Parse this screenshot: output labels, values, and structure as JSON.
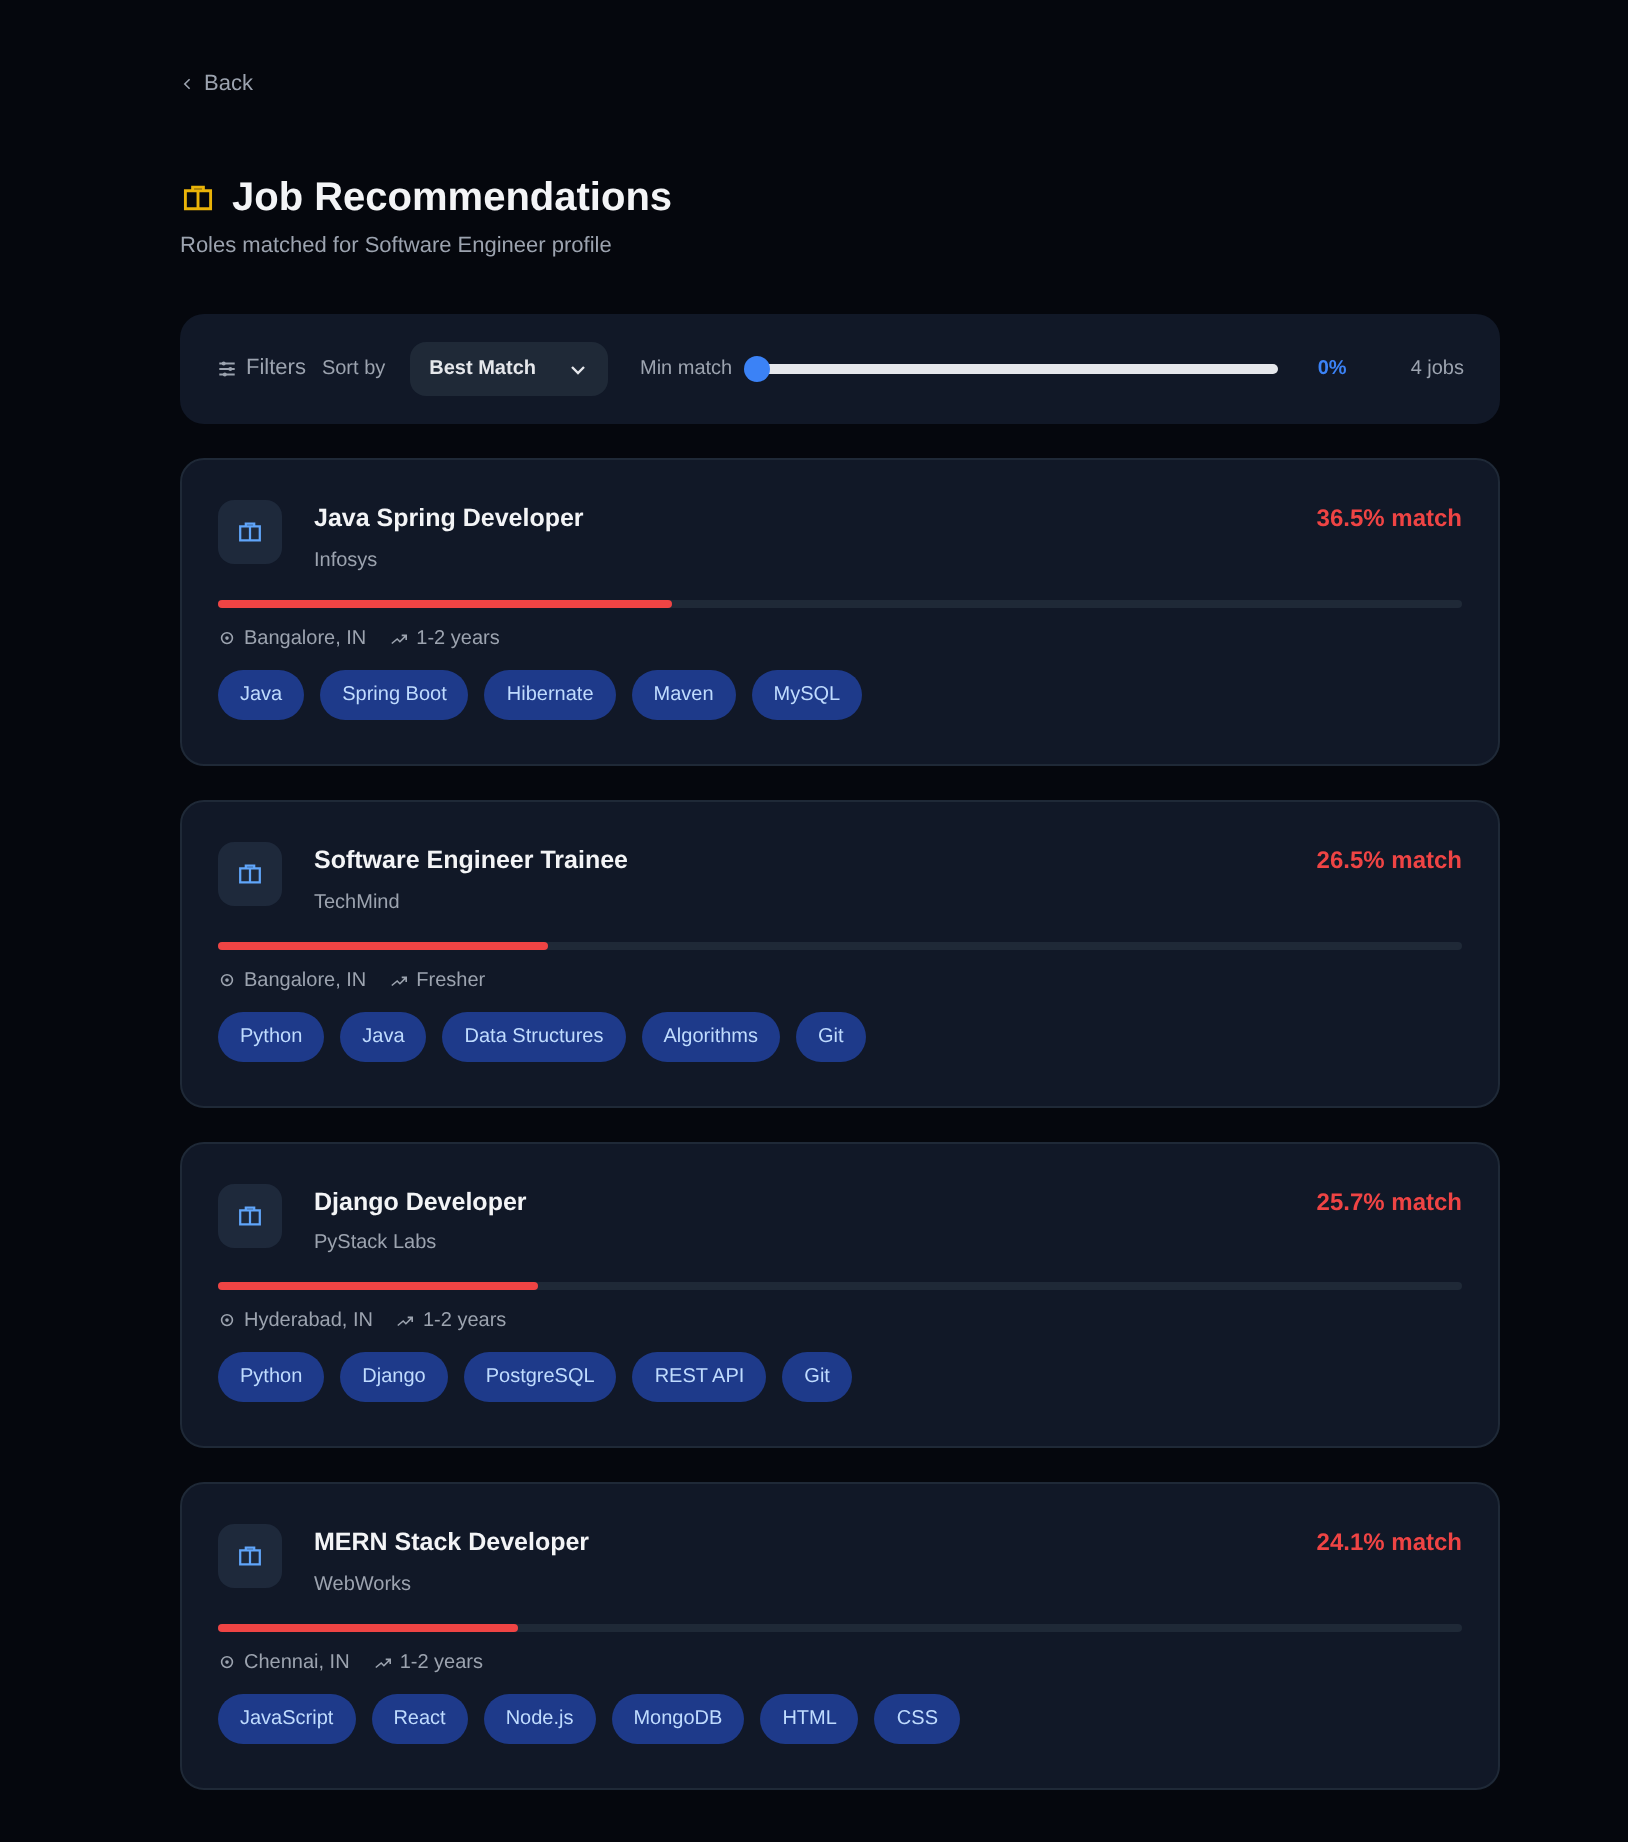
{
  "back": {
    "label": "Back"
  },
  "header": {
    "title": "Job Recommendations",
    "subtitle": "Roles matched for Software Engineer profile"
  },
  "filters": {
    "label": "Filters",
    "sort_label": "Sort by",
    "sort_value": "Best Match",
    "min_match_label": "Min match",
    "min_match": {
      "level": 0
    },
    "min_match_reading": "0%",
    "count": "4 jobs"
  },
  "jobs": [
    {
      "title": "Java Spring Developer",
      "company": "Infosys",
      "match": "36.5% match",
      "level": 0.365,
      "location": "Bangalore, IN",
      "experience": "1-2 years",
      "skills": [
        "Java",
        "Spring Boot",
        "Hibernate",
        "Maven",
        "MySQL"
      ]
    },
    {
      "title": "Software Engineer Trainee",
      "company": "TechMind",
      "match": "26.5% match",
      "level": 0.265,
      "location": "Bangalore, IN",
      "experience": "Fresher",
      "skills": [
        "Python",
        "Java",
        "Data Structures",
        "Algorithms",
        "Git"
      ]
    },
    {
      "title": "Django Developer",
      "company": "PyStack Labs",
      "match": "25.7% match",
      "level": 0.257,
      "location": "Hyderabad, IN",
      "experience": "1-2 years",
      "skills": [
        "Python",
        "Django",
        "PostgreSQL",
        "REST API",
        "Git"
      ]
    },
    {
      "title": "MERN Stack Developer",
      "company": "WebWorks",
      "match": "24.1% match",
      "level": 0.241,
      "location": "Chennai, IN",
      "experience": "1-2 years",
      "skills": [
        "JavaScript",
        "React",
        "Node.js",
        "MongoDB",
        "HTML",
        "CSS"
      ]
    }
  ]
}
